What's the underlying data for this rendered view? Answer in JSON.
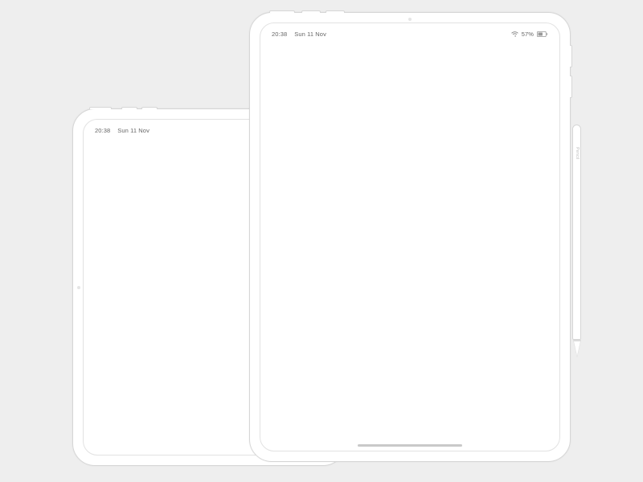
{
  "devices": {
    "small": {
      "status": {
        "time": "20:38",
        "date": "Sun 11 Nov"
      }
    },
    "large": {
      "status": {
        "time": "20:38",
        "date": "Sun 11 Nov",
        "battery_pct": "57%"
      }
    }
  },
  "pencil": {
    "brand_glyph": "",
    "model": "Pencil"
  }
}
